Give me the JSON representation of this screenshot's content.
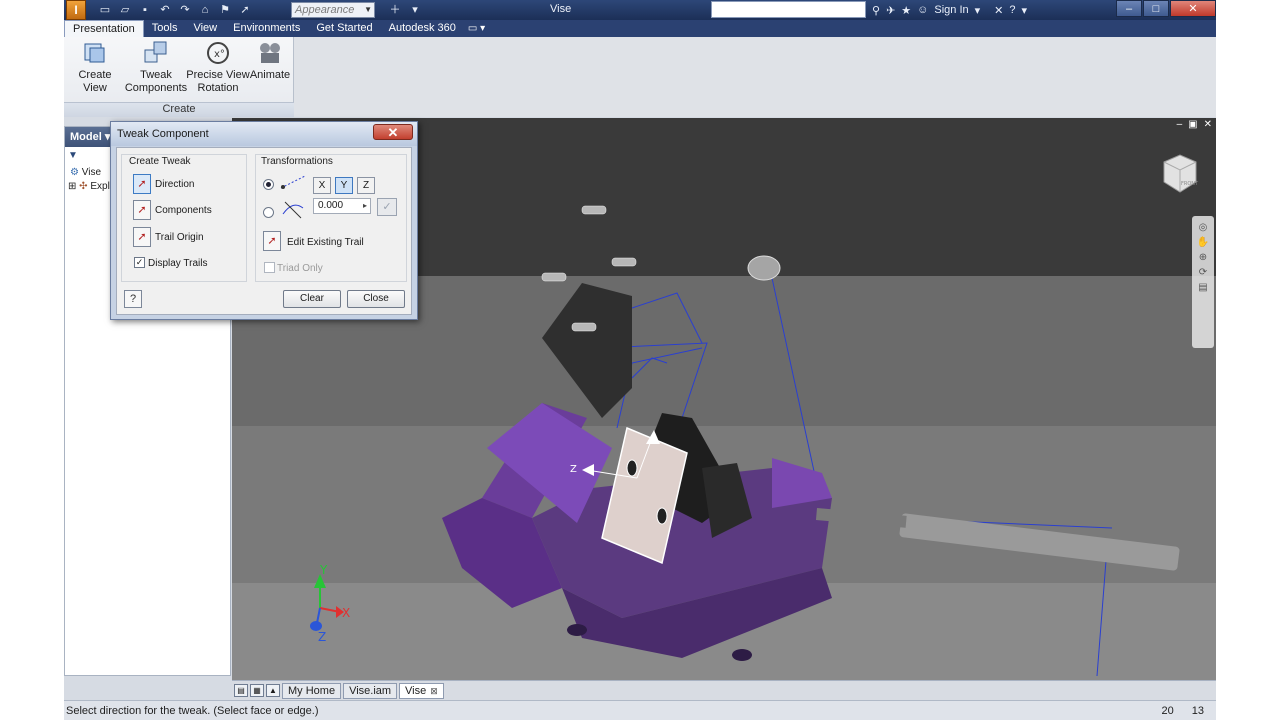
{
  "window": {
    "title": "Vise",
    "logo_text": "I",
    "appearance_placeholder": "Appearance",
    "sign_in": "Sign In"
  },
  "tabs": [
    {
      "label": "Presentation",
      "active": true
    },
    {
      "label": "Tools"
    },
    {
      "label": "View"
    },
    {
      "label": "Environments"
    },
    {
      "label": "Get Started"
    },
    {
      "label": "Autodesk 360"
    }
  ],
  "ribbon": {
    "panel_label": "Create",
    "buttons": [
      {
        "label": "Create View",
        "icon": "create-view-icon"
      },
      {
        "label": "Tweak Components",
        "icon": "tweak-components-icon"
      },
      {
        "label": "Precise View Rotation",
        "icon": "precise-view-rotation-icon"
      },
      {
        "label": "Animate",
        "icon": "animate-icon"
      }
    ]
  },
  "browser": {
    "header": "Model",
    "tree": [
      {
        "label": "Vise"
      },
      {
        "label": "Expl"
      }
    ]
  },
  "dialog": {
    "title": "Tweak Component",
    "create_tweak_label": "Create Tweak",
    "direction": "Direction",
    "components": "Components",
    "trail_origin": "Trail Origin",
    "display_trails": "Display Trails",
    "display_trails_checked": true,
    "transformations_label": "Transformations",
    "axes": [
      "X",
      "Y",
      "Z"
    ],
    "selected_axis": "Y",
    "angle_value": "0.000",
    "edit_existing_trail": "Edit Existing Trail",
    "triad_only": "Triad Only",
    "clear": "Clear",
    "close": "Close"
  },
  "viewport": {
    "triad_labels": {
      "x": "X",
      "y": "Y",
      "z": "Z"
    },
    "viewcube_label": "FRONT",
    "colors": {
      "part": "#6a3d9a",
      "trail": "#2a3fd0"
    }
  },
  "doc_tabs": [
    {
      "label": "My Home"
    },
    {
      "label": "Vise.iam"
    },
    {
      "label": "Vise",
      "active": true
    }
  ],
  "status": {
    "message": "Select direction for the tweak. (Select face or edge.)",
    "num1": "20",
    "num2": "13"
  }
}
